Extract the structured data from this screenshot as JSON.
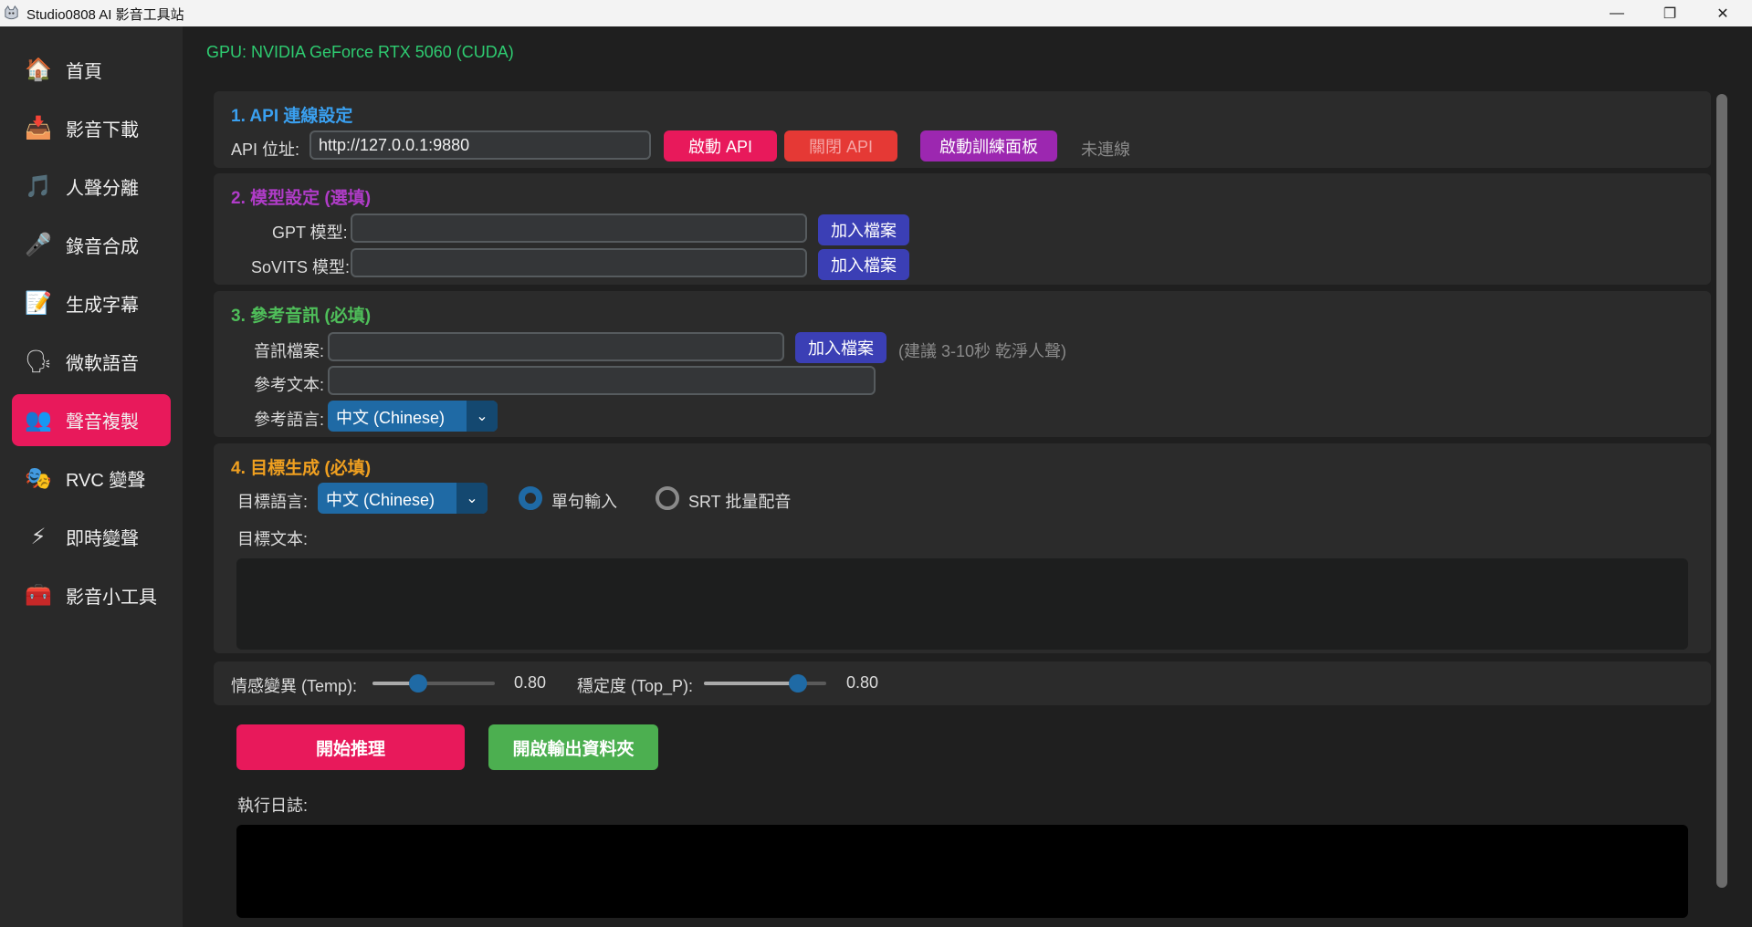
{
  "window": {
    "title": "Studio0808 AI 影音工具站",
    "min_glyph": "—",
    "max_glyph": "❐",
    "close_glyph": "✕"
  },
  "sidebar": {
    "items": [
      {
        "label": "首頁",
        "icon": "home-icon",
        "glyph": "🏠"
      },
      {
        "label": "影音下載",
        "icon": "download-icon",
        "glyph": "📥"
      },
      {
        "label": "人聲分離",
        "icon": "music-note-icon",
        "glyph": "🎵"
      },
      {
        "label": "錄音合成",
        "icon": "microphone-icon",
        "glyph": "🎤"
      },
      {
        "label": "生成字幕",
        "icon": "memo-icon",
        "glyph": "📝"
      },
      {
        "label": "微軟語音",
        "icon": "speaking-head-icon",
        "glyph": "🗣"
      },
      {
        "label": "聲音複製",
        "icon": "users-icon",
        "glyph": "👥"
      },
      {
        "label": "RVC 變聲",
        "icon": "theater-masks-icon",
        "glyph": "🎭"
      },
      {
        "label": "即時變聲",
        "icon": "lightning-icon",
        "glyph": "⚡"
      },
      {
        "label": "影音小工具",
        "icon": "toolbox-icon",
        "glyph": "🧰"
      }
    ],
    "active_index": 6
  },
  "gpu_status": "GPU: NVIDIA GeForce RTX 5060 (CUDA)",
  "section1": {
    "title": "1. API 連線設定",
    "title_color": "#3aa0f0",
    "api_label": "API 位址:",
    "api_value": "http://127.0.0.1:9880",
    "start_api": "啟動 API",
    "stop_api": "關閉 API",
    "start_panel": "啟動訓練面板",
    "status": "未連線"
  },
  "section2": {
    "title": "2. 模型設定 (選填)",
    "title_color": "#b03cc8",
    "gpt_label": "GPT 模型:",
    "gpt_value": "",
    "sovits_label": "SoVITS 模型:",
    "sovits_value": "",
    "add_file": "加入檔案"
  },
  "section3": {
    "title": "3. 參考音訊 (必填)",
    "title_color": "#4fbf5a",
    "audio_label": "音訊檔案:",
    "audio_value": "",
    "add_file": "加入檔案",
    "hint": "(建議 3-10秒 乾淨人聲)",
    "text_label": "參考文本:",
    "text_value": "",
    "lang_label": "參考語言:",
    "lang_value": "中文 (Chinese)"
  },
  "section4": {
    "title": "4. 目標生成 (必填)",
    "title_color": "#f0a020",
    "lang_label": "目標語言:",
    "lang_value": "中文 (Chinese)",
    "radio_single": "單句輸入",
    "radio_srt": "SRT 批量配音",
    "selected_mode": "single",
    "text_label": "目標文本:",
    "text_value": ""
  },
  "sliders": {
    "temp_label": "情感變異 (Temp):",
    "temp_value": "0.80",
    "temp_fraction": 0.37,
    "topp_label": "穩定度 (Top_P):",
    "topp_value": "0.80",
    "topp_fraction": 0.77
  },
  "actions": {
    "start_inference": "開始推理",
    "open_output": "開啟輸出資料夾"
  },
  "log": {
    "label": "執行日誌:",
    "content": ""
  },
  "colors": {
    "accent_pink": "#e8195b",
    "stop_red": "#e53935",
    "purple": "#9c27b0",
    "green": "#4caf50",
    "blue": "#1f6aa5",
    "gpu_green": "#2ecc71"
  }
}
